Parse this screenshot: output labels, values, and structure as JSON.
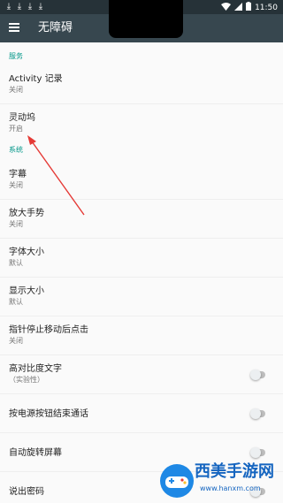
{
  "status_bar": {
    "left_icons": [
      "download-icon",
      "download-icon",
      "download-icon",
      "download-icon"
    ],
    "right_icons": [
      "wifi-icon",
      "signal-icon",
      "battery-icon"
    ],
    "time": "11:50"
  },
  "toolbar": {
    "menu_icon": "menu-icon",
    "title": "无障碍"
  },
  "sections": [
    {
      "header": "服务",
      "items": [
        {
          "title": "Activity 记录",
          "subtitle": "关闭"
        },
        {
          "title": "灵动坞",
          "subtitle": "开启"
        }
      ]
    },
    {
      "header": "系统",
      "items": [
        {
          "title": "字幕",
          "subtitle": "关闭"
        },
        {
          "title": "放大手势",
          "subtitle": "关闭"
        },
        {
          "title": "字体大小",
          "subtitle": "默认"
        },
        {
          "title": "显示大小",
          "subtitle": "默认"
        },
        {
          "title": "指针停止移动后点击",
          "subtitle": "关闭"
        },
        {
          "title": "高对比度文字",
          "subtitle": "（实验性）",
          "toggle": false
        },
        {
          "title": "按电源按钮结束通话",
          "toggle": false
        },
        {
          "title": "自动旋转屏幕",
          "toggle": false
        },
        {
          "title": "说出密码",
          "toggle": false
        }
      ]
    }
  ],
  "watermark": {
    "brand": "西美手游网",
    "url": "www.hanxm.com"
  },
  "colors": {
    "status_bar": "#263238",
    "toolbar": "#37474f",
    "section_header": "#009688",
    "annotation_arrow": "#e53935",
    "watermark": "#1565c0"
  }
}
